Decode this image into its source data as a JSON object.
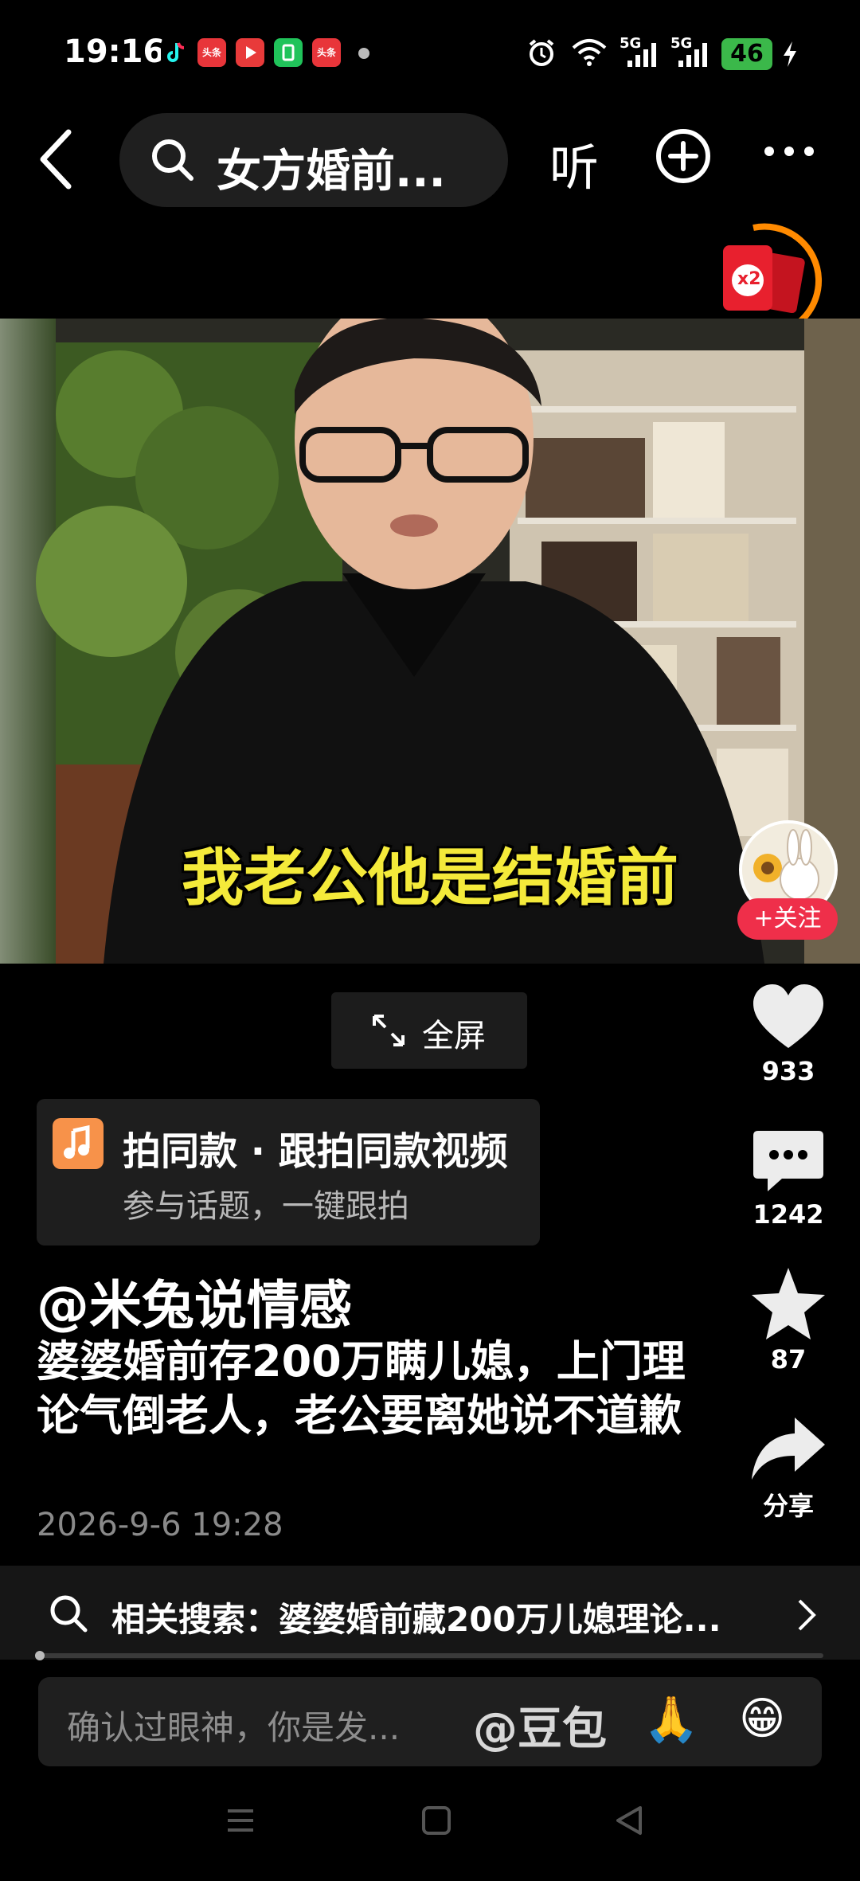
{
  "status_bar": {
    "time": "19:16",
    "app_icons": [
      {
        "name": "tiktok-icon",
        "color": "#000000"
      },
      {
        "name": "toutiao-icon",
        "label": "头条",
        "color": "#e8353a"
      },
      {
        "name": "video-app-icon",
        "color": "#e83a3a"
      },
      {
        "name": "green-app-icon",
        "color": "#20c35a"
      },
      {
        "name": "toutiao-lite-icon",
        "label": "头条",
        "color": "#e8353a"
      }
    ],
    "network_1": "5G",
    "network_2": "5G",
    "battery": "46"
  },
  "top_nav": {
    "search_query": "女方婚前...",
    "listen_label": "听"
  },
  "red_packet": {
    "multiplier": "x2"
  },
  "video": {
    "caption": "我老公他是结婚前"
  },
  "actions": {
    "follow_label": "+关注",
    "like_count": "933",
    "comment_count": "1242",
    "favorite_count": "87",
    "share_label": "分享"
  },
  "fullscreen_label": "全屏",
  "shoot_card": {
    "title": "拍同款 · 跟拍同款视频",
    "subtitle": "参与话题，一键跟拍"
  },
  "post": {
    "author": "@米兔说情感",
    "description": "婆婆婚前存200万瞒儿媳，上门理论气倒老人，老公要离她说不道歉",
    "date": "2026-9-6 19:28"
  },
  "related_search": {
    "text": "相关搜索：婆婆婚前藏200万儿媳理论..."
  },
  "comment_bar": {
    "placeholder": "确认过眼神，你是发...",
    "mention": "@豆包",
    "emoji_1": "🙏",
    "emoji_2": "😁"
  },
  "colors": {
    "accent_red": "#ef2f4a",
    "caption_yellow": "#f4ea3a",
    "music_orange": "#f7924a"
  }
}
